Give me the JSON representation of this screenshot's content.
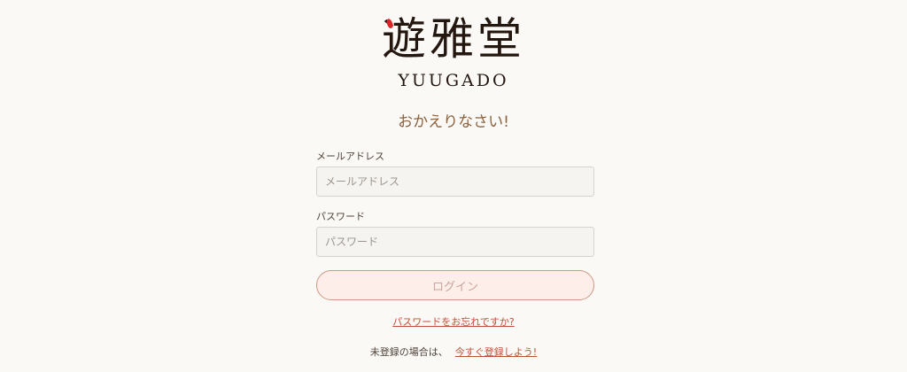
{
  "brand": {
    "logo_kanji": "遊雅堂",
    "logo_roman": "YUUGADO"
  },
  "welcome_text": "おかえりなさい!",
  "form": {
    "email": {
      "label": "メールアドレス",
      "placeholder": "メールアドレス",
      "value": ""
    },
    "password": {
      "label": "パスワード",
      "placeholder": "パスワード",
      "value": ""
    },
    "login_button_label": "ログイン"
  },
  "links": {
    "forgot_password": "パスワードをお忘れですか?",
    "signup_prompt": "未登録の場合は、",
    "signup_link": "今すぐ登録しよう!"
  },
  "colors": {
    "background": "#fbf9f5",
    "accent": "#c0503b",
    "logo_red": "#d8262b",
    "button_fill": "#fdeee9"
  }
}
